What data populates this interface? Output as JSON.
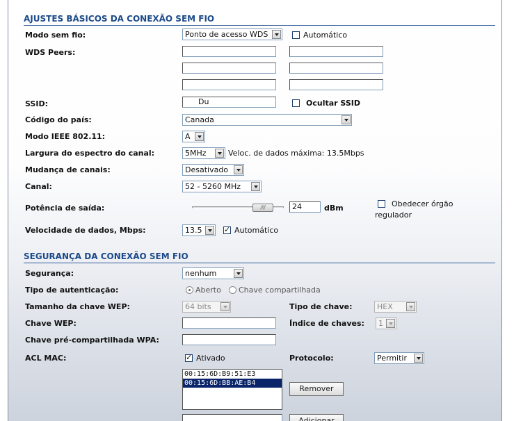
{
  "basic": {
    "title": "AJUSTES BÁSICOS DA CONEXÃO SEM FIO",
    "wireless_mode_label": "Modo sem fio:",
    "wireless_mode_value": "Ponto de acesso WDS",
    "wireless_mode_auto_label": "Automático",
    "wds_peers_label": "WDS Peers:",
    "ssid_label": "SSID:",
    "ssid_value": "Du",
    "hide_ssid_label": "Ocultar SSID",
    "country_label": "Código do país:",
    "country_value": "Canada",
    "ieee_label": "Modo IEEE 802.11:",
    "ieee_value": "A",
    "width_label": "Largura do espectro do canal:",
    "width_value": "5MHz",
    "max_rate_text": "Veloc. de dados máxima: 13.5Mbps",
    "channel_shift_label": "Mudança de canais:",
    "channel_shift_value": "Desativado",
    "channel_label": "Canal:",
    "channel_value": "52 - 5260 MHz",
    "power_label": "Potência de saída:",
    "power_value": "24",
    "power_unit": "dBm",
    "power_slider_fraction": 0.85,
    "obey_line1": "Obedecer órgão",
    "obey_line2": "regulador",
    "rate_label": "Velocidade de dados, Mbps:",
    "rate_value": "13.5",
    "rate_auto_label": "Automático"
  },
  "security": {
    "title": "SEGURANÇA DA CONEXÃO SEM FIO",
    "security_label": "Segurança:",
    "security_value": "nenhum",
    "auth_label": "Tipo de autenticação:",
    "auth_open_label": "Aberto",
    "auth_shared_label": "Chave compartilhada",
    "wep_len_label": "Tamanho da chave WEP:",
    "wep_len_value": "64 bits",
    "key_type_label": "Tipo de chave:",
    "key_type_value": "HEX",
    "wep_key_label": "Chave WEP:",
    "key_index_label": "Índice de chaves:",
    "key_index_value": "1",
    "psk_label": "Chave pré-compartilhada WPA:",
    "acl_label": "ACL MAC:",
    "acl_enabled_label": "Ativado",
    "protocol_label": "Protocolo:",
    "protocol_value": "Permitir",
    "mac_list": [
      "00:15:6D:B9:51:E3",
      "00:15:6D:BB:AE:B4"
    ],
    "remove_label": "Remover",
    "add_label": "Adicionar"
  },
  "colors": {
    "section_title": "#1c4a8a",
    "rule": "#2f5c99",
    "list_selection": "#0a246a"
  }
}
